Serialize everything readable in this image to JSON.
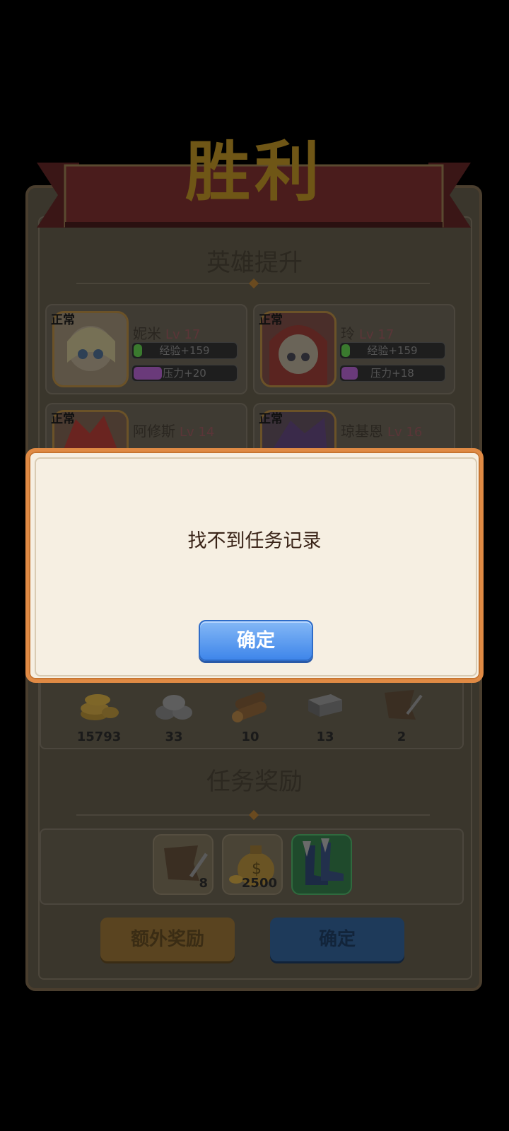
{
  "banner": {
    "title": "胜利"
  },
  "hero_section": {
    "title": "英雄提升"
  },
  "heroes": [
    {
      "status": "正常",
      "name": "妮米",
      "level": "Lv 17",
      "exp": "经验+159",
      "stress": "压力+20",
      "exp_fill": 0.08,
      "stress_fill": 0.28
    },
    {
      "status": "正常",
      "name": "玲",
      "level": "Lv 17",
      "exp": "经验+159",
      "stress": "压力+18",
      "exp_fill": 0.08,
      "stress_fill": 0.16
    },
    {
      "status": "正常",
      "name": "阿修斯",
      "level": "Lv 14"
    },
    {
      "status": "正常",
      "name": "琼基恩",
      "level": "Lv 16"
    }
  ],
  "resources": [
    {
      "icon": "gold-coins-icon",
      "value": "15793"
    },
    {
      "icon": "stone-icon",
      "value": "33"
    },
    {
      "icon": "wood-log-icon",
      "value": "10"
    },
    {
      "icon": "iron-ingot-icon",
      "value": "13"
    },
    {
      "icon": "leather-icon",
      "value": "2"
    }
  ],
  "quest_section": {
    "title": "任务奖励"
  },
  "quest_rewards": [
    {
      "icon": "leather-icon",
      "qty": "8"
    },
    {
      "icon": "money-bag-icon",
      "qty": "2500"
    },
    {
      "icon": "boots-icon",
      "qty": ""
    }
  ],
  "buttons": {
    "extra_reward": "额外奖励",
    "confirm": "确定"
  },
  "dialog": {
    "message": "找不到任务记录",
    "ok_label": "确定"
  }
}
